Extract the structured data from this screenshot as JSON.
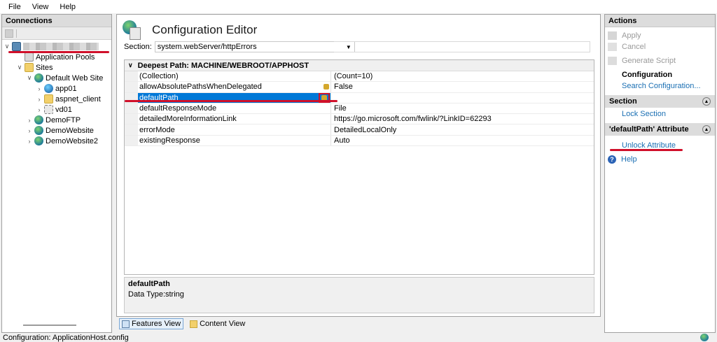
{
  "menu": [
    "File",
    "View",
    "Help"
  ],
  "connections": {
    "title": "Connections",
    "tree": [
      {
        "label": "Application Pools",
        "icon": "app-pool-icon"
      },
      {
        "label": "Sites",
        "icon": "folder-icon"
      },
      {
        "label": "Default Web Site",
        "icon": "globe-icon"
      },
      {
        "label": "app01",
        "icon": "application-icon"
      },
      {
        "label": "aspnet_client",
        "icon": "folder-icon"
      },
      {
        "label": "vd01",
        "icon": "virtual-directory-icon"
      },
      {
        "label": "DemoFTP",
        "icon": "globe-icon"
      },
      {
        "label": "DemoWebsite",
        "icon": "globe-icon"
      },
      {
        "label": "DemoWebsite2",
        "icon": "globe-icon"
      }
    ]
  },
  "editor": {
    "title": "Configuration Editor",
    "section_label": "Section:",
    "section_value": "system.webServer/httpErrors",
    "group_header": "Deepest Path: MACHINE/WEBROOT/APPHOST",
    "rows": [
      {
        "name": "(Collection)",
        "value": "(Count=10)"
      },
      {
        "name": "allowAbsolutePathsWhenDelegated",
        "value": "False"
      },
      {
        "name": "defaultPath",
        "value": ""
      },
      {
        "name": "defaultResponseMode",
        "value": "File"
      },
      {
        "name": "detailedMoreInformationLink",
        "value": "https://go.microsoft.com/fwlink/?LinkID=62293"
      },
      {
        "name": "errorMode",
        "value": "DetailedLocalOnly"
      },
      {
        "name": "existingResponse",
        "value": "Auto"
      }
    ],
    "description": {
      "name": "defaultPath",
      "type": "Data Type:string"
    },
    "views": {
      "features": "Features View",
      "content": "Content View"
    }
  },
  "actions": {
    "title": "Actions",
    "apply": "Apply",
    "cancel": "Cancel",
    "generate_script": "Generate Script",
    "configuration": "Configuration",
    "search_configuration": "Search Configuration...",
    "section_header": "Section",
    "lock_section": "Lock Section",
    "attribute_header": "'defaultPath' Attribute",
    "unlock_attribute": "Unlock Attribute",
    "help": "Help"
  },
  "status": {
    "text": "Configuration: ApplicationHost.config"
  },
  "colors": {
    "selection": "#0078d7",
    "annotation_red": "#d0102a",
    "link": "#1a6fb3"
  }
}
